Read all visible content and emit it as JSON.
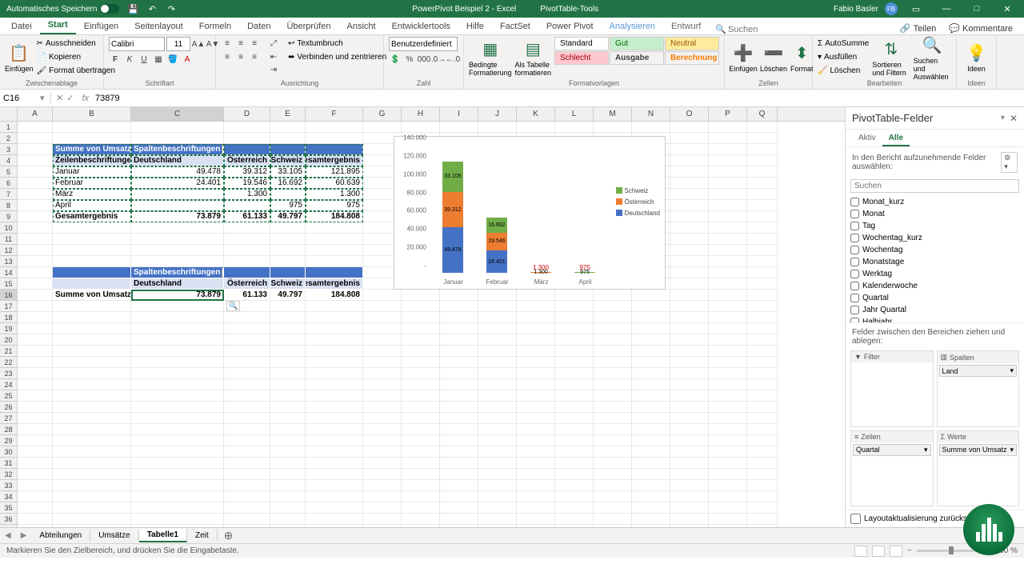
{
  "titlebar": {
    "autosave": "Automatisches Speichern",
    "doc_title": "PowerPivot Beispiel 2 - Excel",
    "tool_tab": "PivotTable-Tools",
    "user_name": "Fabio Basler",
    "user_initials": "FB"
  },
  "ribbon_tabs": [
    "Datei",
    "Start",
    "Einfügen",
    "Seitenlayout",
    "Formeln",
    "Daten",
    "Überprüfen",
    "Ansicht",
    "Entwicklertools",
    "Hilfe",
    "FactSet",
    "Power Pivot",
    "Analysieren",
    "Entwurf"
  ],
  "ribbon_right": {
    "search_placeholder": "Suchen",
    "share": "Teilen",
    "comments": "Kommentare"
  },
  "ribbon": {
    "clipboard": {
      "paste": "Einfügen",
      "cut": "Ausschneiden",
      "copy": "Kopieren",
      "fmt": "Format übertragen",
      "label": "Zwischenablage"
    },
    "font": {
      "name": "Calibri",
      "size": "11",
      "label": "Schriftart"
    },
    "align": {
      "wrap": "Textumbruch",
      "merge": "Verbinden und zentrieren",
      "label": "Ausrichtung"
    },
    "number": {
      "fmt": "Benutzerdefiniert",
      "label": "Zahl"
    },
    "cond": {
      "conditional": "Bedingte Formatierung",
      "table": "Als Tabelle formatieren",
      "label": "Formatvorlagen"
    },
    "styles": {
      "standard": "Standard",
      "gut": "Gut",
      "neutral": "Neutral",
      "schlecht": "Schlecht",
      "ausgabe": "Ausgabe",
      "berechnung": "Berechnung"
    },
    "cells": {
      "insert": "Einfügen",
      "delete": "Löschen",
      "format": "Format",
      "label": "Zellen"
    },
    "editing": {
      "sum": "AutoSumme",
      "fill": "Ausfüllen",
      "clear": "Löschen",
      "sort": "Sortieren und Filtern",
      "find": "Suchen und Auswählen",
      "label": "Bearbeiten"
    },
    "ideas": {
      "btn": "Ideen",
      "label": "Ideen"
    }
  },
  "namebox": "C16",
  "formula": "73879",
  "columns": [
    "A",
    "B",
    "C",
    "D",
    "E",
    "F",
    "G",
    "H",
    "I",
    "J",
    "K",
    "L",
    "M",
    "N",
    "O",
    "P",
    "Q"
  ],
  "pivot1": {
    "row_field": "Zeilenbeschriftungen",
    "col_field": "Spaltenbeschriftungen",
    "value_name": "Summe von Umsatz",
    "cols": [
      "Deutschland",
      "Österreich",
      "Schweiz",
      "Gesamtergebnis"
    ],
    "rows": [
      {
        "label": "Januar",
        "v": [
          "49.478",
          "39.312",
          "33.105",
          "121.895"
        ]
      },
      {
        "label": "Februar",
        "v": [
          "24.401",
          "19.546",
          "16.692",
          "60.639"
        ]
      },
      {
        "label": "März",
        "v": [
          "",
          "1.300",
          "",
          "1.300"
        ]
      },
      {
        "label": "April",
        "v": [
          "",
          "",
          "975",
          "975"
        ]
      }
    ],
    "total": {
      "label": "Gesamtergebnis",
      "v": [
        "73.879",
        "61.133",
        "49.797",
        "184.808"
      ]
    }
  },
  "pivot2": {
    "col_field": "Spaltenbeschriftungen",
    "cols": [
      "Deutschland",
      "Österreich",
      "Schweiz",
      "Gesamtergebnis"
    ],
    "row": {
      "label": "Summe von Umsatz",
      "v": [
        "73.879",
        "61.133",
        "49.797",
        "184.808"
      ]
    }
  },
  "chart_data": {
    "type": "bar",
    "stacked": true,
    "categories": [
      "Januar",
      "Februar",
      "März",
      "April"
    ],
    "series": [
      {
        "name": "Deutschland",
        "color": "#4472c4",
        "values": [
          49478,
          24401,
          0,
          0
        ]
      },
      {
        "name": "Österreich",
        "color": "#ed7d31",
        "values": [
          39312,
          19546,
          1300,
          0
        ]
      },
      {
        "name": "Schweiz",
        "color": "#70ad47",
        "values": [
          33105,
          16692,
          0,
          975
        ]
      }
    ],
    "ylim": [
      0,
      140000
    ],
    "yticks": [
      "-",
      "20.000",
      "40.000",
      "60.000",
      "80.000",
      "100.000",
      "120.000",
      "140.000"
    ],
    "data_labels": {
      "Januar": [
        "49.478",
        "39.312",
        "33.105"
      ],
      "Februar": [
        "24.401",
        "19.546",
        "16.692"
      ],
      "März": [
        "1.300"
      ],
      "April": [
        "975"
      ]
    }
  },
  "sheet_tabs": [
    "Abteilungen",
    "Umsätze",
    "Tabelle1",
    "Zeit"
  ],
  "active_sheet": "Tabelle1",
  "status": "Markieren Sie den Zielbereich, und drücken Sie die Eingabetaste.",
  "zoom": "100 %",
  "pane": {
    "title": "PivotTable-Felder",
    "tab_aktiv": "Aktiv",
    "tab_alle": "Alle",
    "hint": "In den Bericht aufzunehmende Felder auswählen:",
    "search": "Suchen",
    "fields": [
      "Monat_kurz",
      "Monat",
      "Tag",
      "Wochentag_kurz",
      "Wochentag",
      "Monatstage",
      "Werktag",
      "Kalenderwoche",
      "Quartal",
      "Jahr Quartal",
      "Halbjahr"
    ],
    "areas_hint": "Felder zwischen den Bereichen ziehen und ablegen:",
    "filter": "Filter",
    "spalten": "Spalten",
    "zeilen": "Zeilen",
    "werte": "Werte",
    "spalten_val": "Land",
    "zeilen_val": "Quartal",
    "werte_val": "Summe von Umsatz",
    "defer": "Layoutaktualisierung zurückstellen"
  }
}
